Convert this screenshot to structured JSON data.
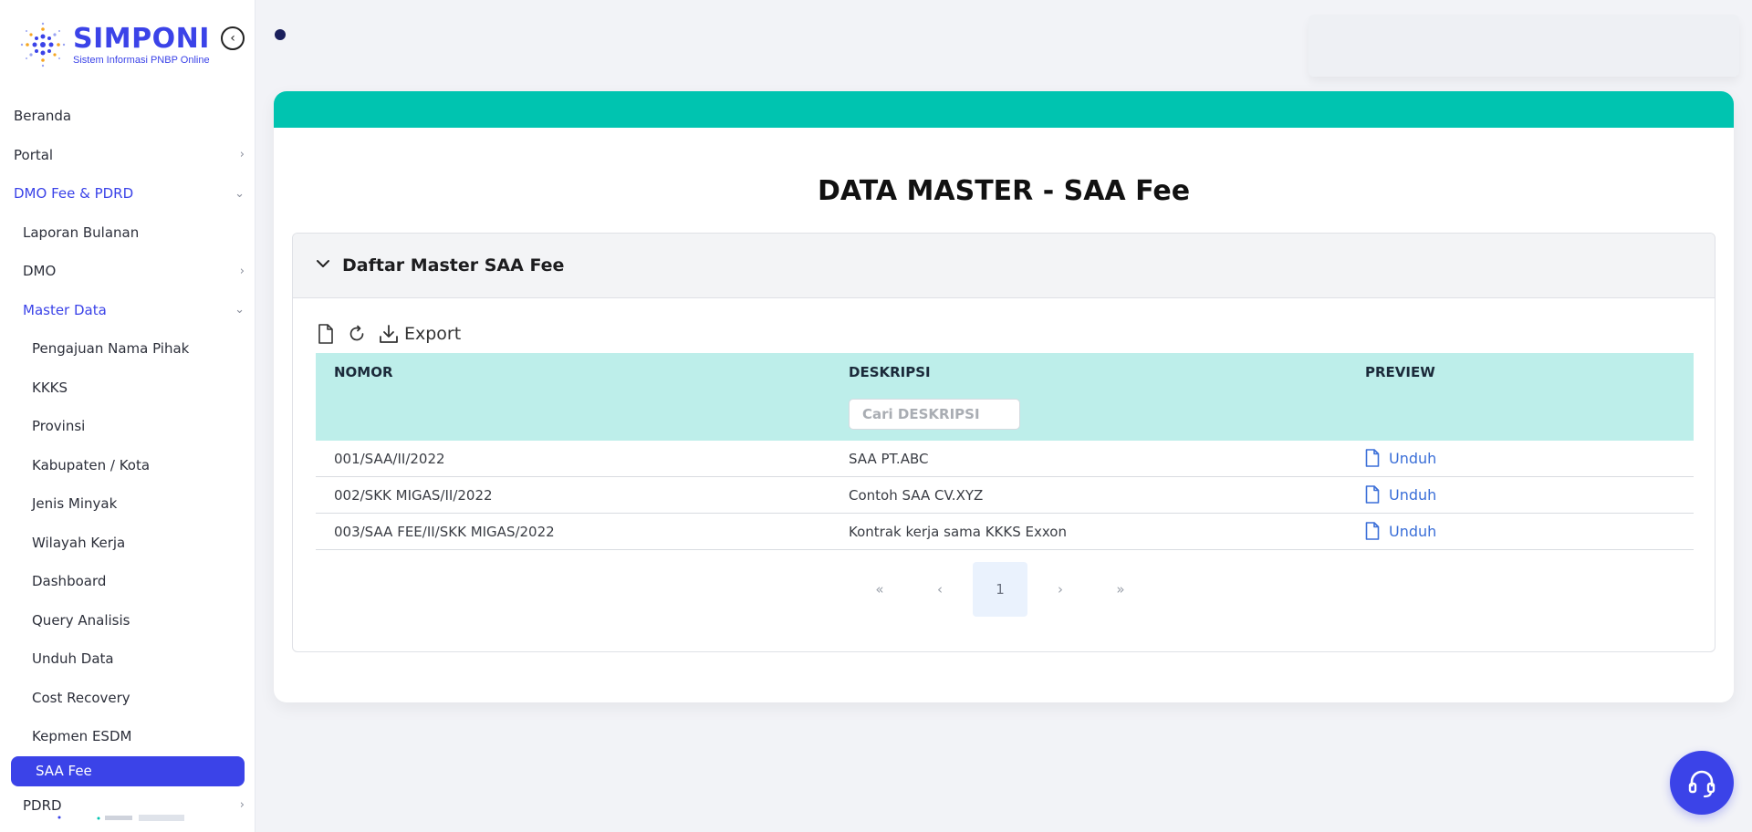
{
  "app": {
    "logo_title": "SIMPONI",
    "logo_subtitle": "Sistem Informasi PNBP Online"
  },
  "sidebar": {
    "items": [
      {
        "label": "Beranda",
        "level": 0,
        "chevron": ""
      },
      {
        "label": "Portal",
        "level": 0,
        "chevron": "right"
      },
      {
        "label": "DMO Fee & PDRD",
        "level": 0,
        "chevron": "down",
        "open": true
      },
      {
        "label": "Laporan Bulanan",
        "level": 1,
        "chevron": ""
      },
      {
        "label": "DMO",
        "level": 1,
        "chevron": "right"
      },
      {
        "label": "Master Data",
        "level": 1,
        "chevron": "down",
        "open": true
      },
      {
        "label": "Pengajuan Nama Pihak",
        "level": 2,
        "chevron": ""
      },
      {
        "label": "KKKS",
        "level": 2,
        "chevron": ""
      },
      {
        "label": "Provinsi",
        "level": 2,
        "chevron": ""
      },
      {
        "label": "Kabupaten / Kota",
        "level": 2,
        "chevron": ""
      },
      {
        "label": "Jenis Minyak",
        "level": 2,
        "chevron": ""
      },
      {
        "label": "Wilayah Kerja",
        "level": 2,
        "chevron": ""
      },
      {
        "label": "Dashboard",
        "level": 2,
        "chevron": ""
      },
      {
        "label": "Query Analisis",
        "level": 2,
        "chevron": ""
      },
      {
        "label": "Unduh Data",
        "level": 2,
        "chevron": ""
      },
      {
        "label": "Cost Recovery",
        "level": 2,
        "chevron": ""
      },
      {
        "label": "Kepmen ESDM",
        "level": 2,
        "chevron": ""
      },
      {
        "label": "SAA Fee",
        "level": 2,
        "chevron": "",
        "active": true
      },
      {
        "label": "PDRD",
        "level": 1,
        "chevron": "right"
      }
    ]
  },
  "main": {
    "page_title": "DATA MASTER - SAA Fee",
    "panel_title": "Daftar Master SAA Fee",
    "toolbar": {
      "export_label": "Export"
    },
    "table": {
      "columns": [
        "NOMOR",
        "DESKRIPSI",
        "PREVIEW"
      ],
      "search_placeholder": "Cari DESKRIPSI",
      "rows": [
        {
          "nomor": "001/SAA/II/2022",
          "deskripsi": "SAA PT.ABC",
          "preview": "Unduh"
        },
        {
          "nomor": "002/SKK MIGAS/II/2022",
          "deskripsi": "Contoh SAA CV.XYZ",
          "preview": "Unduh"
        },
        {
          "nomor": "003/SAA FEE/II/SKK MIGAS/2022",
          "deskripsi": "Kontrak kerja sama KKKS Exxon",
          "preview": "Unduh"
        }
      ]
    },
    "pagination": {
      "first": "«",
      "prev": "‹",
      "current_page": "1",
      "next": "›",
      "last": "»"
    }
  },
  "colors": {
    "brand": "#3b43e8",
    "header_band": "#00c4b0",
    "table_header": "#bdeeea",
    "link": "#3b6fd8"
  },
  "icons": {
    "collapse": "chevron-left-circle-icon",
    "new_doc": "file-icon",
    "refresh": "refresh-icon",
    "export": "download-icon",
    "preview": "file-icon",
    "help": "headset-icon"
  }
}
